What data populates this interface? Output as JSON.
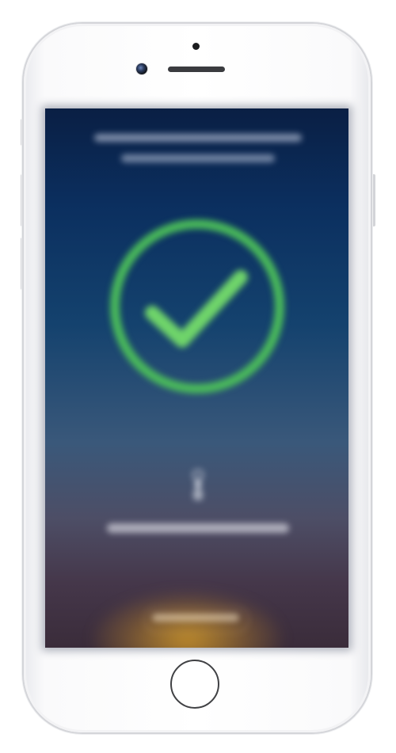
{
  "device": {
    "model": "iphone-white-silver"
  },
  "screen": {
    "header_line_1": "",
    "header_line_2": "",
    "status": {
      "icon": "check-icon",
      "color": "#4cc05a"
    },
    "instruction_icon": "hand-tap-icon",
    "instruction_text": "",
    "button_label": ""
  },
  "colors": {
    "screen_top": "#0a1f44",
    "screen_mid": "#14426e",
    "screen_bottom": "#3a2c3a",
    "accent_glow": "#d69c28",
    "check_green": "#4cc05a"
  }
}
